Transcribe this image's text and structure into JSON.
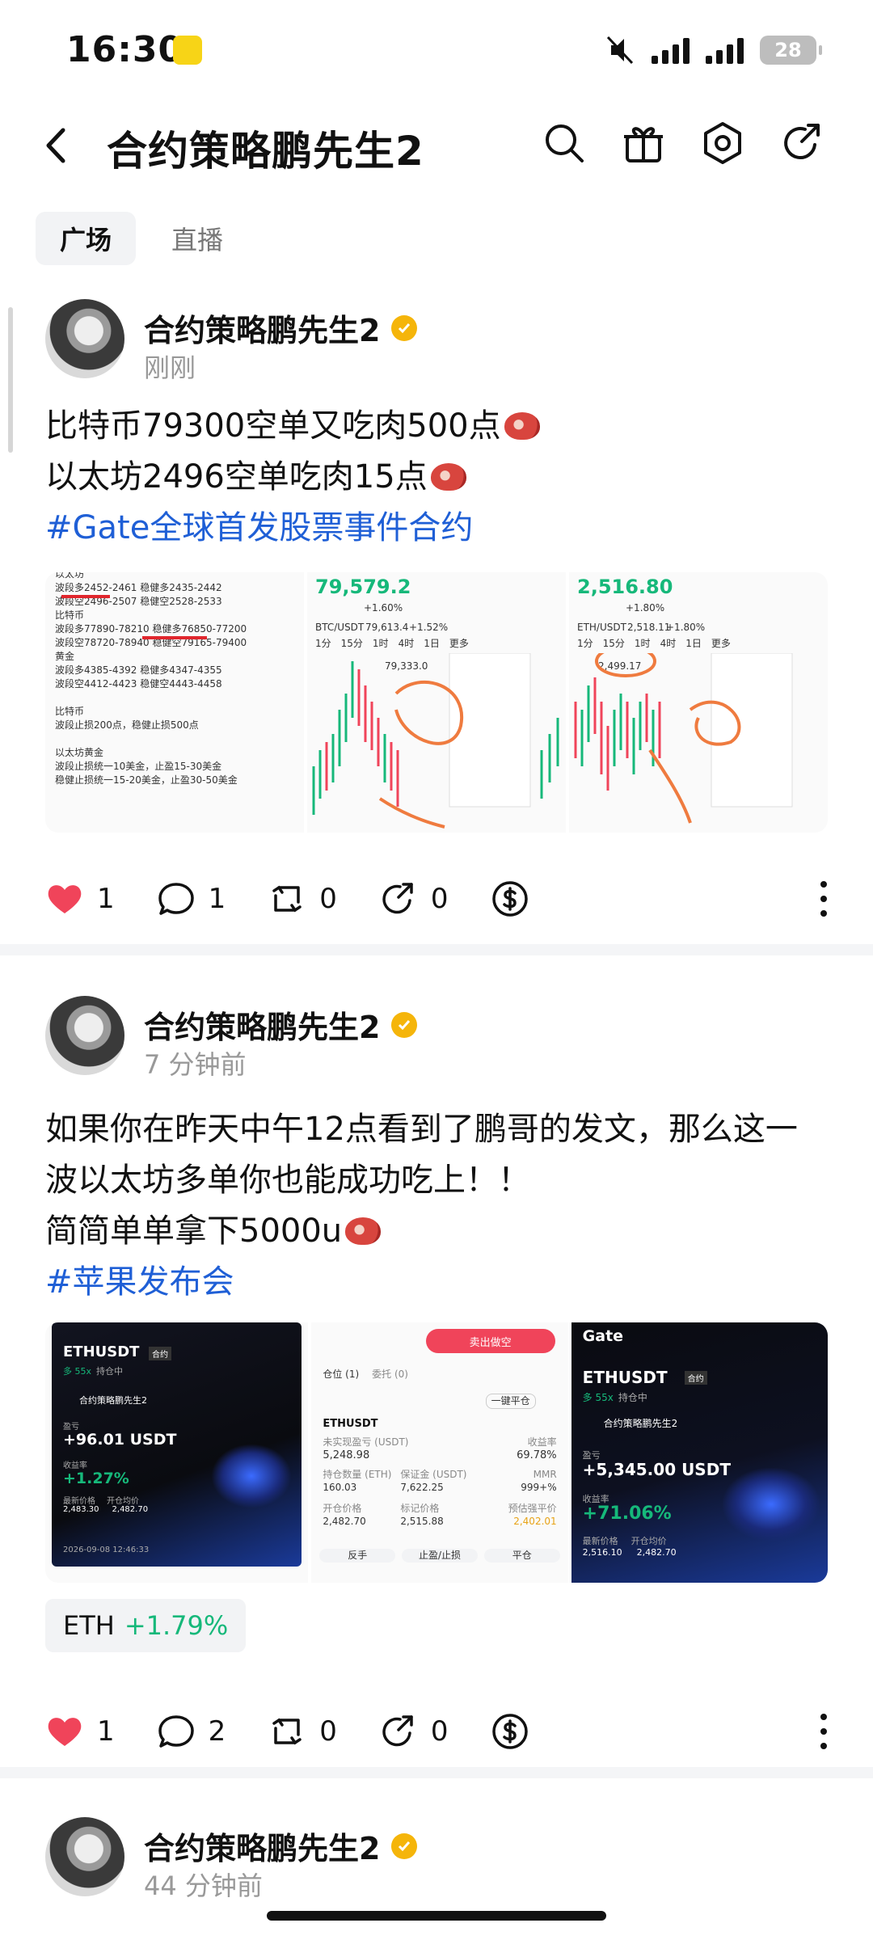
{
  "status": {
    "time": "16:30",
    "battery": "28"
  },
  "header": {
    "title": "合约策略鹏先生2"
  },
  "tabs": [
    {
      "label": "广场",
      "active": true
    },
    {
      "label": "直播",
      "active": false
    }
  ],
  "posts": [
    {
      "author": "合约策略鹏先生2",
      "time": "刚刚",
      "lines": [
        "比特币79300空单又吃肉500点",
        "以太坊2496空单吃肉15点"
      ],
      "hashtag": "#Gate全球首发股票事件合约",
      "images": {
        "note": {
          "lines": [
            "以太坊",
            "波段多2452-2461 稳健多2435-2442",
            "波段空2496-2507 稳健空2528-2533",
            "比特币",
            "波段多77890-78210 稳健多76850-77200",
            "波段空78720-78940 稳健空79165-79400",
            "黄金",
            "波段多4385-4392 稳健多4347-4355",
            "波段空4412-4423 稳健空4443-4458",
            "",
            "比特币",
            "波段止损200点，稳健止损500点",
            "",
            "以太坊黄金",
            "波段止损统一10美金，止盈15-30美金",
            "稳健止损统一15-20美金，止盈30-50美金"
          ]
        },
        "btc": {
          "price": "79,579.2",
          "change": "+1.60%",
          "pair": "BTC/USDT",
          "pair_price": "79,613.4",
          "pair_change": "+1.52%",
          "tab_1": "1分",
          "tab_2": "15分",
          "tab_3": "1时",
          "tab_4": "4时",
          "tab_5": "1日",
          "more": "更多",
          "marker": "79,333.0"
        },
        "eth": {
          "price": "2,516.80",
          "change": "+1.80%",
          "pair": "ETH/USDT",
          "pair_price": "2,518.11",
          "pair_change": "+1.80%",
          "tab_1": "1分",
          "tab_2": "15分",
          "tab_3": "1时",
          "tab_4": "4时",
          "tab_5": "1日",
          "more": "更多",
          "marker": "2,499.17"
        }
      },
      "likes": "1",
      "comments": "1",
      "reposts": "0",
      "shares": "0"
    },
    {
      "author": "合约策略鹏先生2",
      "time": "7 分钟前",
      "lines": [
        "如果你在昨天中午12点看到了鹏哥的发文，那么这一",
        "波以太坊多单你也能成功吃上！！",
        "简简单单拿下5000u"
      ],
      "hashtag": "#苹果发布会",
      "images": {
        "card1": {
          "symbol": "ETHUSDT",
          "tag": "合约",
          "side": "多 55x",
          "status": "持仓中",
          "user": "合约策略鹏先生2",
          "pnl_label": "盈亏",
          "pnl": "+96.01 USDT",
          "rate_label": "收益率",
          "rate": "+1.27%",
          "last_label": "最新价格",
          "open_label": "开仓均价",
          "last": "2,483.30",
          "open": "2,482.70",
          "date": "2026-09-08 12:46:33"
        },
        "order": {
          "sell_btn": "卖出做空",
          "tab_positions": "仓位 (1)",
          "tab_orders": "委托 (0)",
          "close_all": "一键平仓",
          "symbol": "ETHUSDT",
          "unreal_label": "未实现盈亏 (USDT)",
          "unreal": "5,248.98",
          "roe_label": "收益率",
          "roe": "69.78%",
          "qty_label": "持仓数量 (ETH)",
          "qty": "160.03",
          "margin_label": "保证金 (USDT)",
          "margin": "7,622.25",
          "mmr_label": "MMR",
          "mmr": "999+%",
          "entry_label": "开仓价格",
          "entry": "2,482.70",
          "mark_label": "标记价格",
          "mark": "2,515.88",
          "liq_label": "预估强平价",
          "liq": "2,402.01",
          "btn_reverse": "反手",
          "btn_tpsl": "止盈/止损",
          "btn_close": "平仓"
        },
        "card2": {
          "logo": "Gate",
          "symbol": "ETHUSDT",
          "tag": "合约",
          "side": "多 55x",
          "status": "持仓中",
          "user": "合约策略鹏先生2",
          "pnl_label": "盈亏",
          "pnl": "+5,345.00 USDT",
          "rate_label": "收益率",
          "rate": "+71.06%",
          "last_label": "最新价格",
          "open_label": "开仓均价",
          "last": "2,516.10",
          "open": "2,482.70"
        }
      },
      "token": {
        "symbol": "ETH",
        "change": "+1.79%"
      },
      "likes": "1",
      "comments": "2",
      "reposts": "0",
      "shares": "0"
    },
    {
      "author": "合约策略鹏先生2",
      "time": "44 分钟前"
    }
  ],
  "colors": {
    "accent_blue": "#1f5fd6",
    "like_red": "#f0445a",
    "green": "#16b87a",
    "verified": "#f5b50a"
  }
}
